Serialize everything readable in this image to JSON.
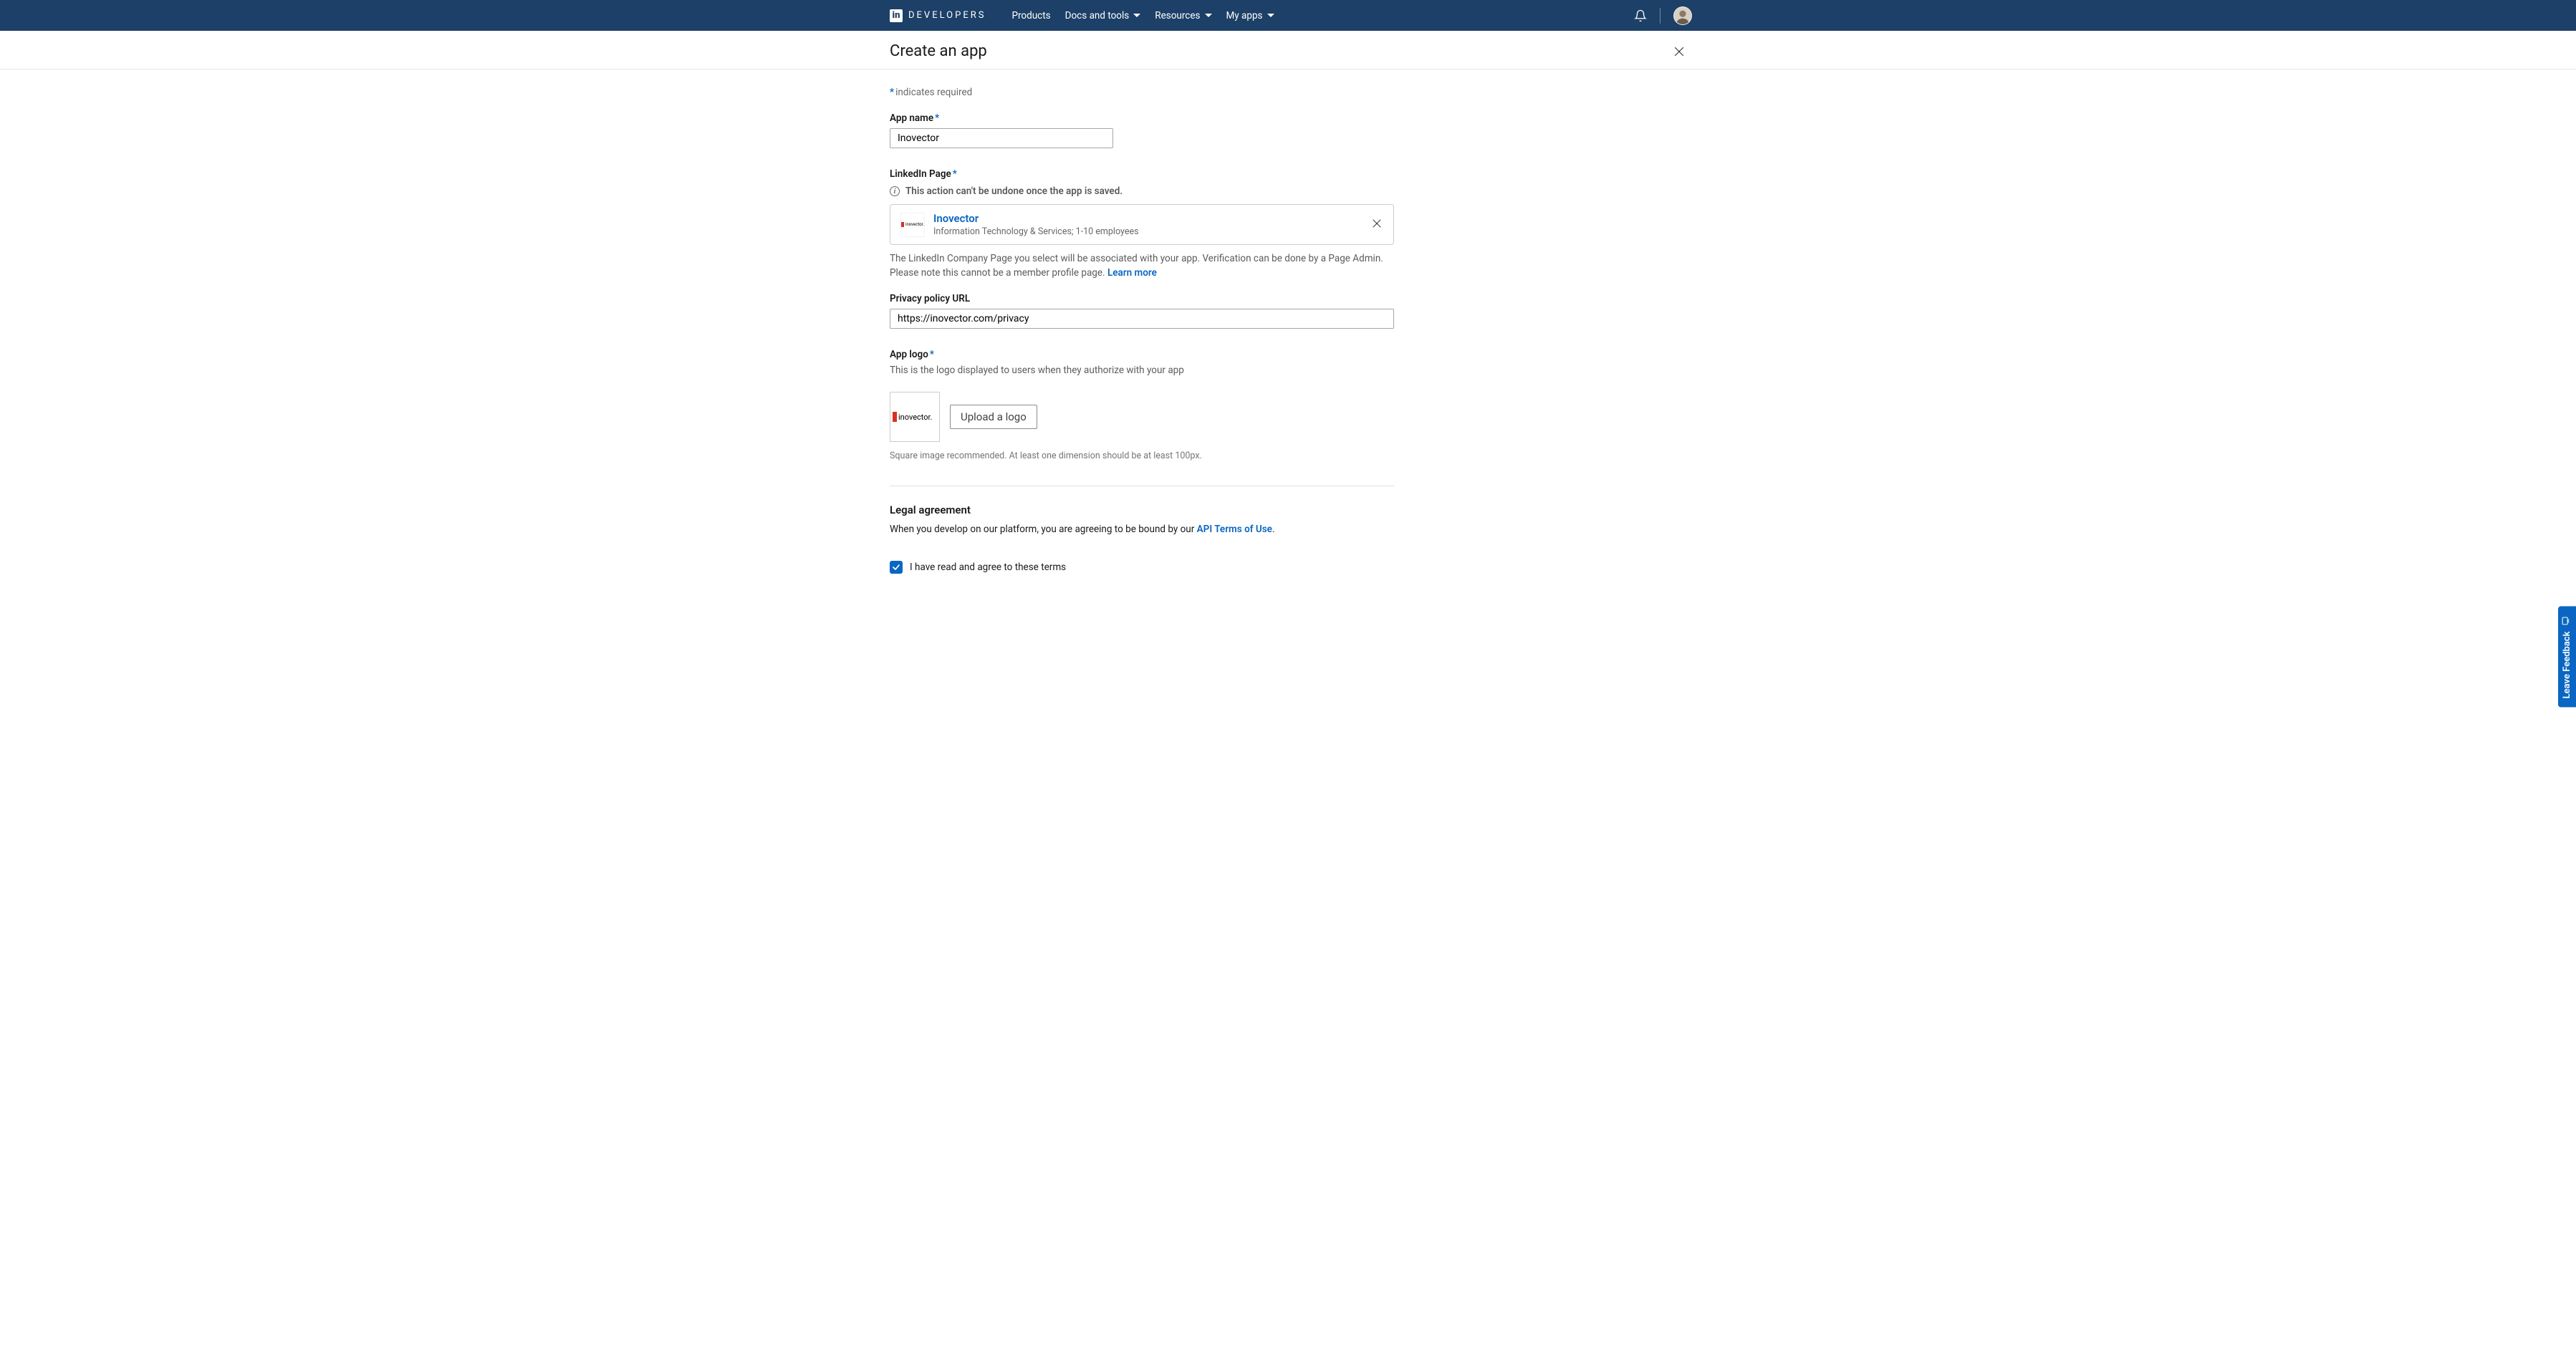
{
  "nav": {
    "logo_label": "in",
    "brand": "DEVELOPERS",
    "items": [
      {
        "label": "Products",
        "has_dropdown": false
      },
      {
        "label": "Docs and tools",
        "has_dropdown": true
      },
      {
        "label": "Resources",
        "has_dropdown": true
      },
      {
        "label": "My apps",
        "has_dropdown": true
      }
    ]
  },
  "page": {
    "title": "Create an app",
    "required_hint": "indicates required"
  },
  "form": {
    "app_name": {
      "label": "App name",
      "value": "Inovector"
    },
    "linkedin_page": {
      "label": "LinkedIn Page",
      "warning": "This action can't be undone once the app is saved.",
      "company": {
        "name": "Inovector",
        "subtitle": "Information Technology & Services; 1-10 employees",
        "logo_text": "inovector."
      },
      "help_text_1": "The LinkedIn Company Page you select will be associated with your app. Verification can be done by a Page Admin. Please note this cannot be a member profile page. ",
      "learn_more": "Learn more"
    },
    "privacy_url": {
      "label": "Privacy policy URL",
      "value": "https://inovector.com/privacy"
    },
    "app_logo": {
      "label": "App logo",
      "desc": "This is the logo displayed to users when they authorize with your app",
      "upload_button": "Upload a logo",
      "hint": "Square image recommended. At least one dimension should be at least 100px.",
      "preview_text": "inovector."
    },
    "legal": {
      "title": "Legal agreement",
      "text_before": "When you develop on our platform, you are agreeing to be bound by our ",
      "terms_link": "API Terms of Use",
      "text_after": ".",
      "checkbox_label": "I have read and agree to these terms"
    }
  },
  "feedback_tab": "Leave Feedback"
}
